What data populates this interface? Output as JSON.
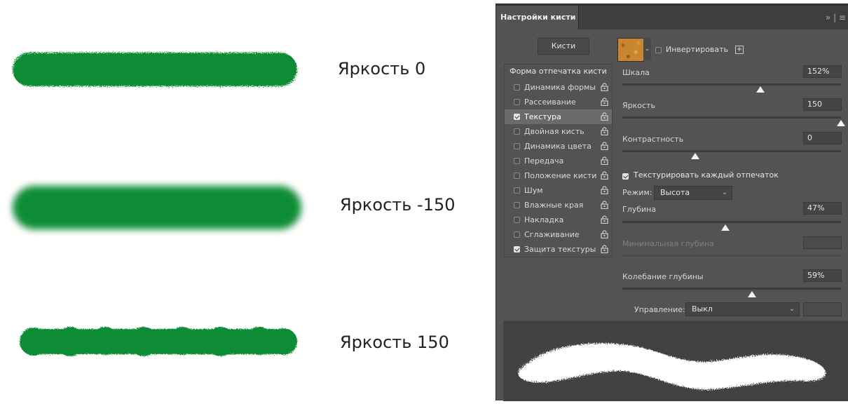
{
  "examples": [
    {
      "label": "Яркость 0"
    },
    {
      "label": "Яркость -150"
    },
    {
      "label": "Яркость 150"
    }
  ],
  "colors": {
    "stroke": "#0d8c35",
    "panel_bg": "#535353",
    "title_bg": "#3e3e3e"
  },
  "panel": {
    "tab_title": "Настройки кисти",
    "menu_icon": "panel-menu-icon",
    "menu_glyph": "» | ≡",
    "brushes_button": "Кисти",
    "tip_list": {
      "header": "Форма отпечатка кисти",
      "items": [
        {
          "label": "Динамика формы",
          "checked": false,
          "selected": false
        },
        {
          "label": "Рассеивание",
          "checked": false,
          "selected": false
        },
        {
          "label": "Текстура",
          "checked": true,
          "selected": true
        },
        {
          "label": "Двойная кисть",
          "checked": false,
          "selected": false
        },
        {
          "label": "Динамика цвета",
          "checked": false,
          "selected": false
        },
        {
          "label": "Передача",
          "checked": false,
          "selected": false
        },
        {
          "label": "Положение кисти",
          "checked": false,
          "selected": false
        },
        {
          "label": "Шум",
          "checked": false,
          "selected": false
        },
        {
          "label": "Влажные края",
          "checked": false,
          "selected": false
        },
        {
          "label": "Накладка",
          "checked": false,
          "selected": false
        },
        {
          "label": "Сглаживание",
          "checked": false,
          "selected": false
        },
        {
          "label": "Защита текстуры",
          "checked": true,
          "selected": false
        }
      ]
    },
    "texture": {
      "invert_label": "Инвертировать",
      "invert_checked": false,
      "new_preset_glyph": "+"
    },
    "scale": {
      "label": "Шкала",
      "value": "152%"
    },
    "brightness": {
      "label": "Яркость",
      "value": "150"
    },
    "contrast": {
      "label": "Контрастность",
      "value": "0"
    },
    "each_tip": {
      "label": "Текстурировать каждый отпечаток",
      "checked": true
    },
    "mode": {
      "label": "Режим:",
      "value": "Высота"
    },
    "depth": {
      "label": "Глубина",
      "value": "47%"
    },
    "min_depth": {
      "label": "Минимальная глубина",
      "value": ""
    },
    "depth_jitter": {
      "label": "Колебание глубины",
      "value": "59%"
    },
    "control": {
      "label": "Управление:",
      "value": "Выкл"
    }
  }
}
